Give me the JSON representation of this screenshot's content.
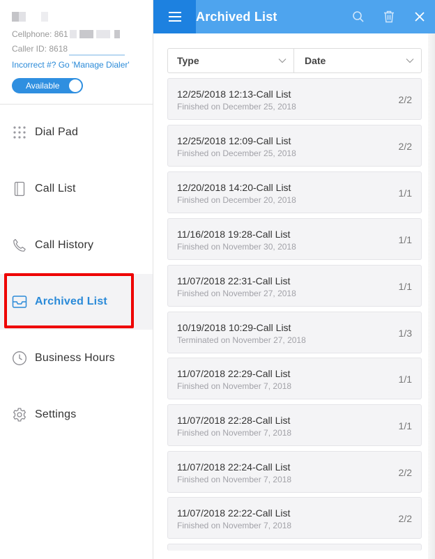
{
  "profile": {
    "cellphone": "Cellphone: 861",
    "caller_id": "Caller ID: 8618",
    "manage_link": "Incorrect #? Go 'Manage Dialer'",
    "status_toggle": "Available"
  },
  "nav": {
    "items": [
      {
        "label": "Dial Pad",
        "icon": "dial-pad-icon"
      },
      {
        "label": "Call List",
        "icon": "call-list-icon"
      },
      {
        "label": "Call History",
        "icon": "phone-icon"
      },
      {
        "label": "Archived List",
        "icon": "inbox-icon",
        "active": true
      },
      {
        "label": "Business Hours",
        "icon": "clock-icon"
      },
      {
        "label": "Settings",
        "icon": "gear-icon"
      }
    ]
  },
  "header": {
    "title": "Archived List",
    "icons": [
      "menu-icon",
      "search-icon",
      "trash-icon",
      "close-icon"
    ]
  },
  "filters": {
    "type": "Type",
    "date": "Date"
  },
  "archived": [
    {
      "title": "12/25/2018 12:13-Call List",
      "subtitle": "Finished on December 25, 2018",
      "count": "2/2"
    },
    {
      "title": "12/25/2018 12:09-Call List",
      "subtitle": "Finished on December 25, 2018",
      "count": "2/2"
    },
    {
      "title": "12/20/2018 14:20-Call List",
      "subtitle": "Finished on December 20, 2018",
      "count": "1/1"
    },
    {
      "title": "11/16/2018 19:28-Call List",
      "subtitle": "Finished on November 30, 2018",
      "count": "1/1"
    },
    {
      "title": "11/07/2018 22:31-Call List",
      "subtitle": "Finished on November 27, 2018",
      "count": "1/1"
    },
    {
      "title": "10/19/2018 10:29-Call List",
      "subtitle": "Terminated on November 27, 2018",
      "count": "1/3"
    },
    {
      "title": "11/07/2018 22:29-Call List",
      "subtitle": "Finished on November 7, 2018",
      "count": "1/1"
    },
    {
      "title": "11/07/2018 22:28-Call List",
      "subtitle": "Finished on November 7, 2018",
      "count": "1/1"
    },
    {
      "title": "11/07/2018 22:24-Call List",
      "subtitle": "Finished on November 7, 2018",
      "count": "2/2"
    },
    {
      "title": "11/07/2018 22:22-Call List",
      "subtitle": "Finished on November 7, 2018",
      "count": "2/2"
    }
  ],
  "colors": {
    "accent": "#2a8ad8",
    "header": "#4ea4ee",
    "highlight": "#ee0000"
  }
}
